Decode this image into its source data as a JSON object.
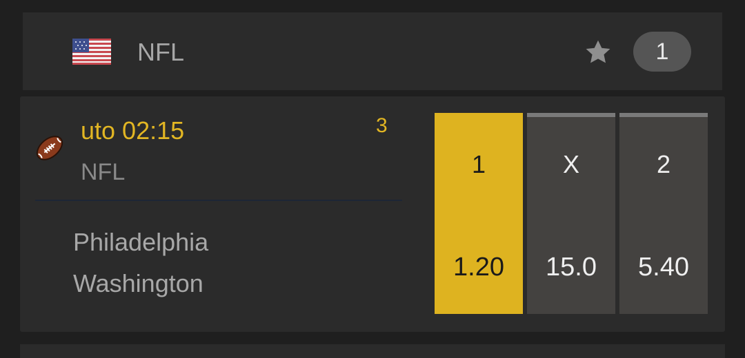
{
  "league_header": {
    "flag_icon": "us-flag-icon",
    "title": "NFL",
    "favorite_icon": "star-icon",
    "event_count": "1"
  },
  "event": {
    "sport_icon": "american-football-icon",
    "time": "uto 02:15",
    "markets_count": "3",
    "league": "NFL",
    "home_team": "Philadelphia",
    "away_team": "Washington",
    "odds": [
      {
        "label": "1",
        "price": "1.20",
        "selected": true
      },
      {
        "label": "X",
        "price": "15.0",
        "selected": false
      },
      {
        "label": "2",
        "price": "5.40",
        "selected": false
      }
    ]
  },
  "colors": {
    "accent": "#deb320",
    "time_text": "#e2b623",
    "card_bg": "#2b2b2b",
    "page_bg": "#1f1f1f",
    "odds_bg": "#444240",
    "badge_bg": "#555555"
  }
}
